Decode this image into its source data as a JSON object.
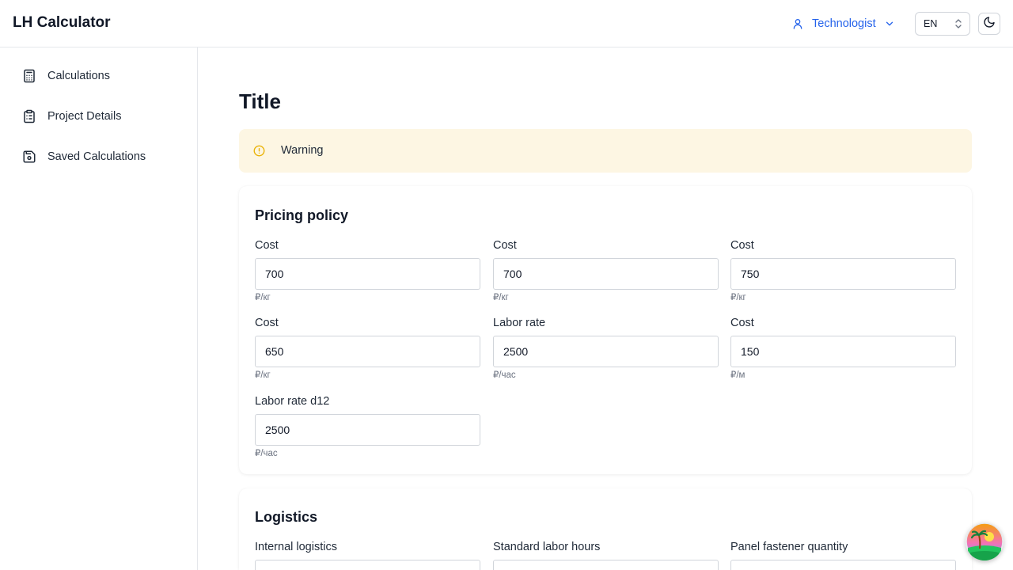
{
  "app": {
    "title": "LH Calculator"
  },
  "header": {
    "role_label": "Technologist",
    "language": "EN"
  },
  "sidebar": {
    "items": [
      {
        "label": "Calculations",
        "icon": "calculator-icon"
      },
      {
        "label": "Project Details",
        "icon": "clipboard-list-icon"
      },
      {
        "label": "Saved Calculations",
        "icon": "save-icon"
      }
    ]
  },
  "main": {
    "title": "Title",
    "warning": "Warning",
    "pricing": {
      "title": "Pricing policy",
      "fields": [
        {
          "label": "Cost",
          "value": "700",
          "unit": "₽/кг"
        },
        {
          "label": "Cost",
          "value": "700",
          "unit": "₽/кг"
        },
        {
          "label": "Cost",
          "value": "750",
          "unit": "₽/кг"
        },
        {
          "label": "Cost",
          "value": "650",
          "unit": "₽/кг"
        },
        {
          "label": "Labor rate",
          "value": "2500",
          "unit": "₽/час"
        },
        {
          "label": "Cost",
          "value": "150",
          "unit": "₽/м"
        },
        {
          "label": "Labor rate d12",
          "value": "2500",
          "unit": "₽/час"
        }
      ]
    },
    "logistics": {
      "title": "Logistics",
      "fields": [
        {
          "label": "Internal logistics",
          "value": ""
        },
        {
          "label": "Standard labor hours",
          "value": ""
        },
        {
          "label": "Panel fastener quantity",
          "value": ""
        }
      ]
    }
  },
  "colors": {
    "accent": "#2563eb",
    "warning_bg": "#fdf6e3",
    "warning_icon": "#eab308"
  }
}
